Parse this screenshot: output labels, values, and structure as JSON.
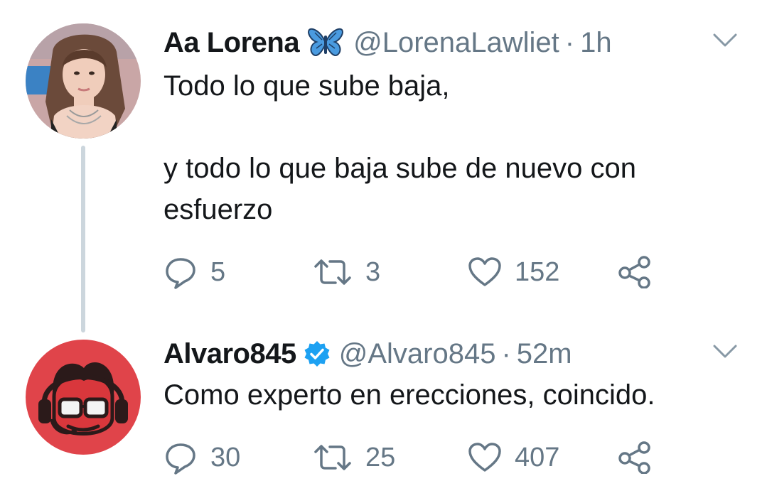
{
  "tweets": [
    {
      "name": "Aa Lorena",
      "badge_icon": "butterfly-emoji",
      "handle": "@LorenaLawliet",
      "separator": "·",
      "time": "1h",
      "text_lines": [
        "Todo lo que sube baja,",
        "y todo lo que baja sube de nuevo con",
        "esfuerzo"
      ],
      "replies": "5",
      "retweets": "3",
      "likes": "152"
    },
    {
      "name": "Alvaro845",
      "badge_icon": "verified-badge-icon",
      "handle": "@Alvaro845",
      "separator": "·",
      "time": "52m",
      "text_lines": [
        "Como experto en erecciones, coincido."
      ],
      "replies": "30",
      "retweets": "25",
      "likes": "407"
    }
  ],
  "colors": {
    "text": "#14171a",
    "muted": "#657786",
    "thread_line": "#ccd6dd",
    "verified": "#1da1f2",
    "butterfly": "#4a9be0",
    "alvaro_avatar_bg": "#e0444a"
  }
}
